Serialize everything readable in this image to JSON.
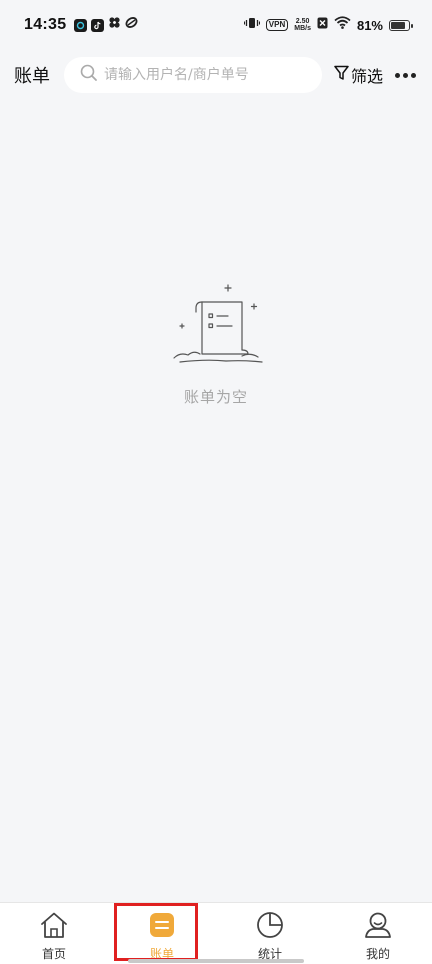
{
  "status_bar": {
    "time": "14:35",
    "vpn": "VPN",
    "speed_value": "2.50",
    "speed_unit": "MB/s",
    "battery": "81%",
    "battery_level": 0.81
  },
  "header": {
    "title": "账单",
    "search_placeholder": "请输入用户名/商户单号",
    "filter_label": "筛选"
  },
  "empty_state": {
    "message": "账单为空"
  },
  "tabs": [
    {
      "label": "首页",
      "icon": "home-icon",
      "active": false
    },
    {
      "label": "账单",
      "icon": "bill-icon",
      "active": true
    },
    {
      "label": "统计",
      "icon": "pie-chart-icon",
      "active": false
    },
    {
      "label": "我的",
      "icon": "profile-icon",
      "active": false
    }
  ],
  "colors": {
    "accent": "#f0a93a",
    "background": "#f5f6f8",
    "highlight": "#e02020"
  }
}
